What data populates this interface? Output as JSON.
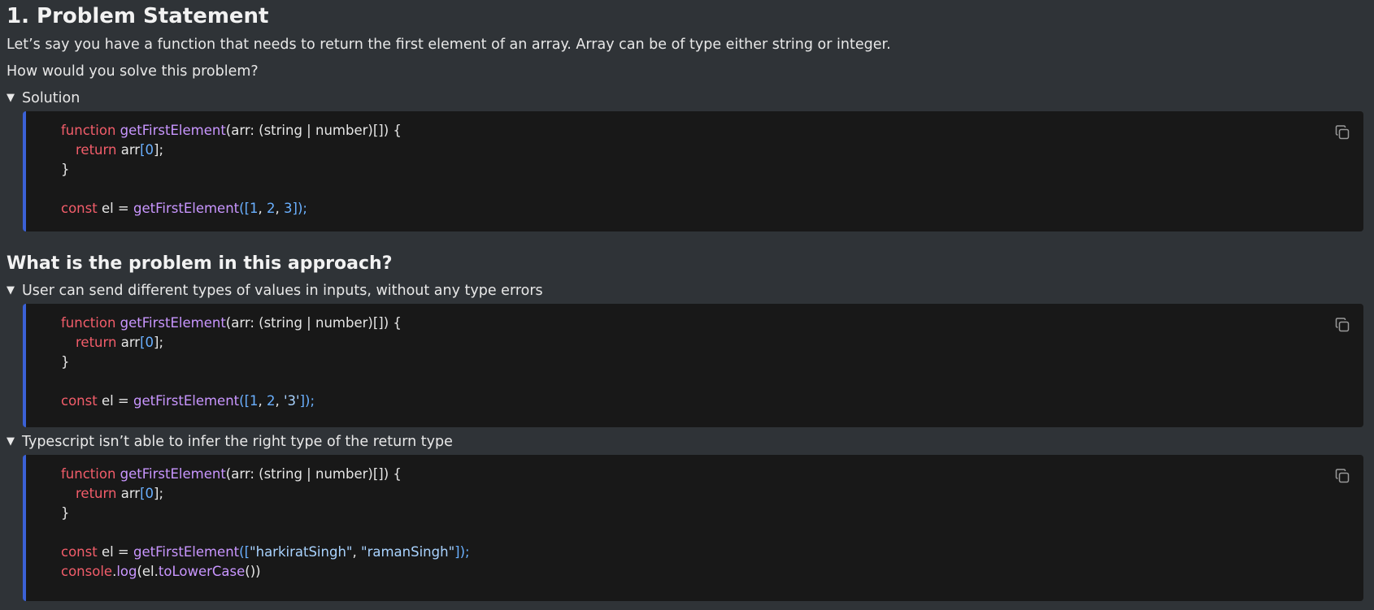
{
  "heading": "1. Problem Statement",
  "intro": "Let’s say you have a function that needs to return the first element of an array. Array can be of type either string or integer.",
  "question": "How would you solve this problem?",
  "toggles": [
    {
      "label": "Solution",
      "expanded": true
    },
    {
      "label": "User can send different types of values in inputs, without any type errors",
      "expanded": true
    },
    {
      "label": "Typescript isn’t able to infer the right type of the return type",
      "expanded": true
    }
  ],
  "subheading": "What is the problem in this approach?",
  "code": {
    "kw_function": "function",
    "fn_name": "getFirstElement",
    "params": "(arr: (string | number)[]) {",
    "kw_return": "return",
    "arr": "arr",
    "bracket_open": "[",
    "zero": "0",
    "bracket_close": "];",
    "close_brace": "}",
    "kw_const": "const",
    "el_assign": " el = ",
    "call_open": "([",
    "n1": "1",
    "n2": "2",
    "n3": "3",
    "comma": ", ",
    "call_close": "]);",
    "str_3": "'3'",
    "str_harkirat": "\"harkiratSingh\"",
    "str_raman": "\"ramanSingh\"",
    "console": "console",
    "dot": ".",
    "log": "log",
    "log_open": "(el.",
    "to_lower": "toLowerCase",
    "log_close": "())"
  },
  "colors": {
    "background": "#2f3337",
    "code_background": "#181818",
    "accent_border": "#3b61d6",
    "keyword": "#f25d6a",
    "function": "#c996ff",
    "number": "#6ab0ff"
  },
  "icons": {
    "toggle": "triangle-down-icon",
    "copy": "copy-icon"
  }
}
